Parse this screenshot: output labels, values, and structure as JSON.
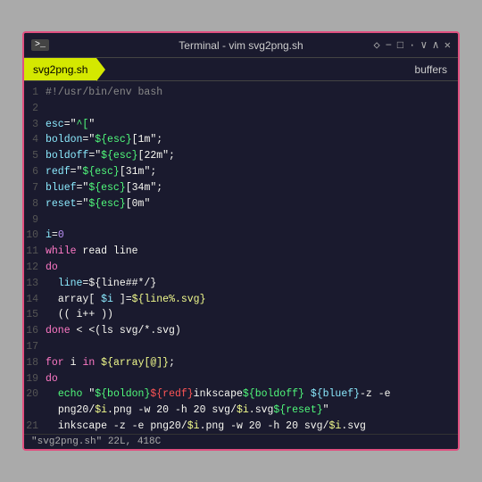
{
  "window": {
    "title": "Terminal - vim svg2png.sh",
    "tab_name": "svg2png.sh",
    "buffers_label": "buffers",
    "status_bar": "\"svg2png.sh\" 22L, 418C"
  },
  "titlebar": {
    "icon": ">_",
    "controls": [
      "◇",
      "−",
      "□",
      "·",
      "∨",
      "∧",
      "✕"
    ]
  }
}
